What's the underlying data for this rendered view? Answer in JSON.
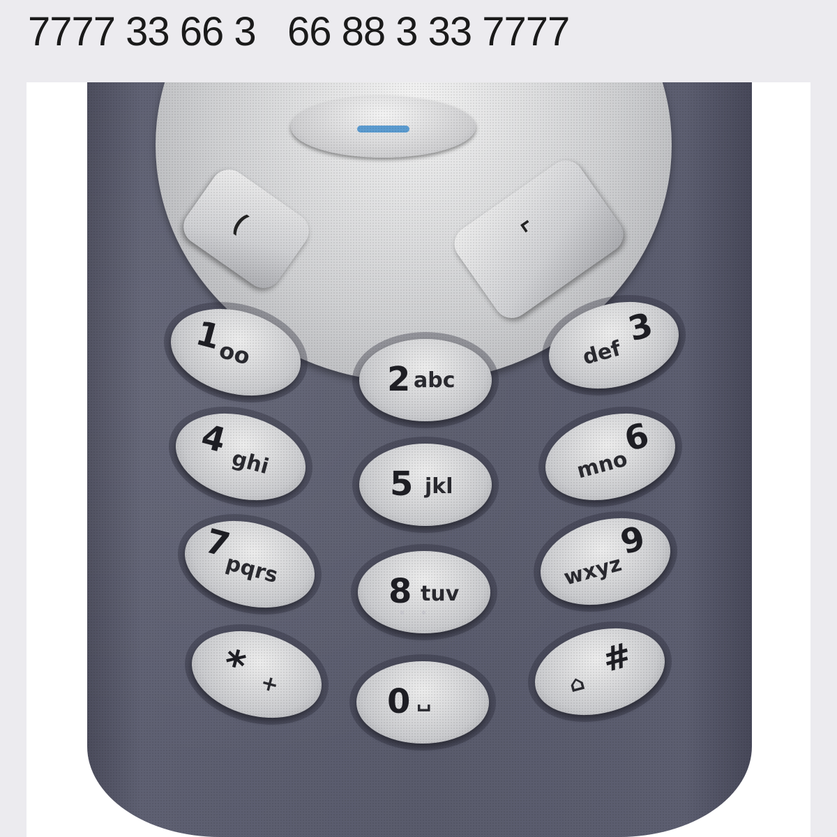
{
  "caption": "7777 33 66 3   66 88 3 33 7777",
  "phone": {
    "keys": [
      {
        "num": "1",
        "letters": "σο"
      },
      {
        "num": "2",
        "letters": "abc"
      },
      {
        "num": "3",
        "letters": "def"
      },
      {
        "num": "4",
        "letters": "ghi"
      },
      {
        "num": "5",
        "letters": "jkl"
      },
      {
        "num": "6",
        "letters": "mno"
      },
      {
        "num": "7",
        "letters": "pqrs"
      },
      {
        "num": "8",
        "letters": "tuv"
      },
      {
        "num": "9",
        "letters": "wxyz"
      },
      {
        "num": "*",
        "letters": "+"
      },
      {
        "num": "0",
        "letters": "␣"
      },
      {
        "num": "#",
        "letters": "⌂"
      }
    ],
    "soft_left_icon": "(",
    "soft_right_icon": "⌐",
    "accent_color": "#5b9bd0",
    "body_color": "#595b6c"
  }
}
